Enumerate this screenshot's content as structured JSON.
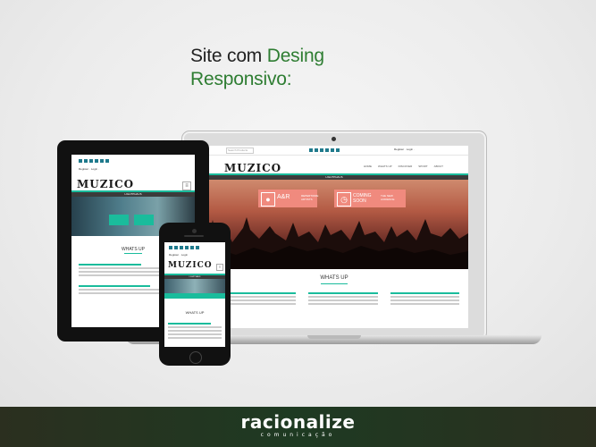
{
  "headline": {
    "prefix": "Site com ",
    "accent": "Desing",
    "line2": "Responsivo:"
  },
  "laptop_site": {
    "search_placeholder": "Search Products",
    "register_login": "Register  ·  Login ·",
    "logo": "MUZICO",
    "nav": [
      "HOME",
      "WHATS UP",
      "DISCOVER",
      "SPORT",
      "ABOUT"
    ],
    "bar_label": "LIGHTPHAUS",
    "box1_label": "A&R",
    "box1_sub": "REPERTOIRE ARTISTS",
    "box2_label": "COMING SOON",
    "box2_sub": "THE NEW AUDIENCE",
    "section_title": "WHATS UP"
  },
  "tablet_site": {
    "register_login": "Register  ·  Login ·",
    "logo": "MUZICO",
    "bar_label": "LIGHTPHAUS",
    "section_title": "WHATS UP"
  },
  "phone_site": {
    "register_login": "Register  ·  Login",
    "logo": "MUZICO",
    "bar_label": "LIGHTPHAUS",
    "section_title": "WHATS UP"
  },
  "footer": {
    "brand": "racionalize",
    "brand_sub": "comunicação"
  },
  "colors": {
    "accent_green": "#2e7d32",
    "site_teal": "#1abc9c",
    "hero_box": "#f08a7e",
    "footer_dark": "#1e3a22"
  }
}
